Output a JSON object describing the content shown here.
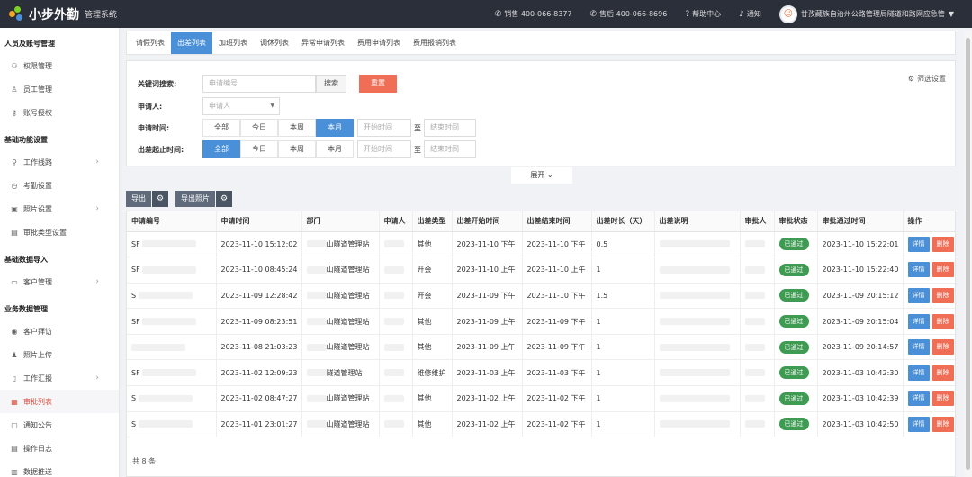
{
  "header": {
    "app_name": "小步外勤",
    "app_sub": "管理系统",
    "sales": "销售 400-066-8377",
    "after_sales": "售后 400-066-8696",
    "help": "帮助中心",
    "notice": "通知",
    "user_name": "甘孜藏族自治州公路管理局隧道和路网应急管"
  },
  "sidebar": {
    "sections": [
      {
        "title": "人员及账号管理",
        "items": [
          {
            "label": "权限管理"
          },
          {
            "label": "员工管理"
          },
          {
            "label": "账号授权"
          }
        ]
      },
      {
        "title": "基础功能设置",
        "items": [
          {
            "label": "工作线路"
          },
          {
            "label": "考勤设置"
          },
          {
            "label": "照片设置"
          },
          {
            "label": "审批类型设置"
          }
        ]
      },
      {
        "title": "基础数据导入",
        "items": [
          {
            "label": "客户管理"
          }
        ]
      },
      {
        "title": "业务数据管理",
        "items": [
          {
            "label": "客户拜访"
          },
          {
            "label": "照片上传"
          },
          {
            "label": "工作汇报"
          },
          {
            "label": "审批列表"
          },
          {
            "label": "通知公告"
          },
          {
            "label": "操作日志"
          },
          {
            "label": "数据推送"
          }
        ]
      }
    ]
  },
  "tabs": [
    "请假列表",
    "出差列表",
    "加班列表",
    "调休列表",
    "异常申请列表",
    "费用申请列表",
    "费用报销列表"
  ],
  "filter": {
    "keyword_label": "关键词搜索:",
    "keyword_placeholder": "申请编号",
    "search_btn": "搜索",
    "reset_btn": "重置",
    "settings": "筛选设置",
    "applicant_label": "申请人:",
    "applicant_placeholder": "申请人",
    "apply_time_label": "申请时间:",
    "trip_time_label": "出差起止时间:",
    "seg": [
      "全部",
      "今日",
      "本周",
      "本月"
    ],
    "start_placeholder": "开始时间",
    "end_placeholder": "结束时间",
    "tilde": "至",
    "expand": "展开"
  },
  "toolbar": {
    "export": "导出",
    "export_photo": "导出照片"
  },
  "table": {
    "headers": [
      "申请编号",
      "申请时间",
      "部门",
      "申请人",
      "出差类型",
      "出差开始时间",
      "出差结束时间",
      "出差时长（天）",
      "出差说明",
      "审批人",
      "审批状态",
      "审批通过时间",
      "操作"
    ],
    "rows": [
      {
        "id": "SF",
        "time": "2023-11-10 15:12:02",
        "dept": "山隧道管理站",
        "type": "其他",
        "start": "2023-11-10 下午",
        "end": "2023-11-10 下午",
        "days": "0.5",
        "status": "已通过",
        "pass": "2023-11-10 15:22:01"
      },
      {
        "id": "SF",
        "time": "2023-11-10 08:45:24",
        "dept": "山隧道管理站",
        "type": "开会",
        "start": "2023-11-10 上午",
        "end": "2023-11-10 上午",
        "days": "1",
        "status": "已通过",
        "pass": "2023-11-10 15:22:40"
      },
      {
        "id": "S",
        "time": "2023-11-09 12:28:42",
        "dept": "山隧道管理站",
        "type": "开会",
        "start": "2023-11-09 下午",
        "end": "2023-11-10 下午",
        "days": "1.5",
        "status": "已通过",
        "pass": "2023-11-09 20:15:12"
      },
      {
        "id": "SF",
        "time": "2023-11-09 08:23:51",
        "dept": "山隧道管理站",
        "type": "其他",
        "start": "2023-11-09 上午",
        "end": "2023-11-09 下午",
        "days": "1",
        "status": "已通过",
        "pass": "2023-11-09 20:15:04"
      },
      {
        "id": "",
        "time": "2023-11-08 21:03:23",
        "dept": "山隧道管理站",
        "type": "其他",
        "start": "2023-11-09 上午",
        "end": "2023-11-09 下午",
        "days": "1",
        "status": "已通过",
        "pass": "2023-11-09 20:14:57"
      },
      {
        "id": "SF",
        "time": "2023-11-02 12:09:23",
        "dept": "隧道管理站",
        "type": "维修维护",
        "start": "2023-11-03 上午",
        "end": "2023-11-03 下午",
        "days": "1",
        "status": "已通过",
        "pass": "2023-11-03 10:42:30"
      },
      {
        "id": "S",
        "time": "2023-11-02 08:47:27",
        "dept": "山隧道管理站",
        "type": "其他",
        "start": "2023-11-02 上午",
        "end": "2023-11-02 下午",
        "days": "1",
        "status": "已通过",
        "pass": "2023-11-03 10:42:39"
      },
      {
        "id": "S",
        "time": "2023-11-01 23:01:27",
        "dept": "山隧道管理站",
        "type": "其他",
        "start": "2023-11-02 上午",
        "end": "2023-11-02 下午",
        "days": "1",
        "status": "已通过",
        "pass": "2023-11-03 10:42:50"
      }
    ],
    "detail": "详情",
    "delete": "删除",
    "total": "共 8 条"
  },
  "colors": {
    "primary": "#4a90d9",
    "danger": "#f06e56",
    "success": "#3d9b52",
    "topbar": "#2b2f3a"
  }
}
